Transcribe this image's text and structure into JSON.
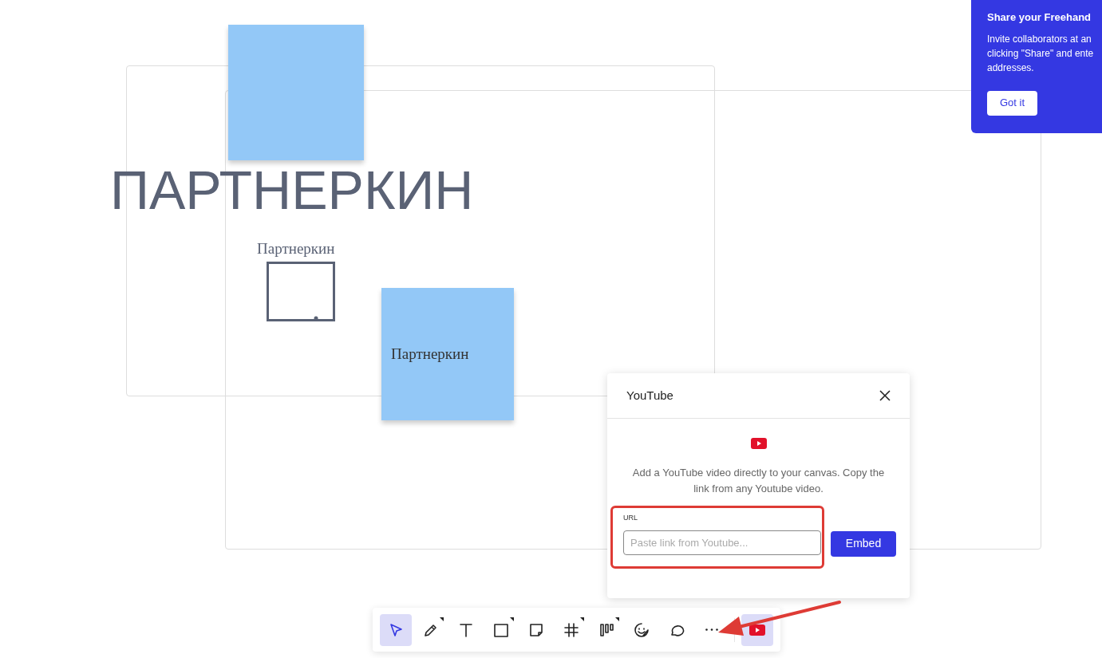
{
  "canvas": {
    "handwriting": "ПАРТНЕРКИН",
    "text_label": "Партнеркин",
    "sticky_notes": [
      {
        "color": "#93c8f7"
      },
      {
        "text": "Партнеркин",
        "color": "#93c8f7"
      }
    ]
  },
  "tip": {
    "title": "Share your Freehand",
    "lines": [
      "Invite collaborators at an",
      "clicking \"Share\" and ente",
      "addresses."
    ],
    "button": "Got it"
  },
  "dialog": {
    "title": "YouTube",
    "description": "Add a YouTube video directly to your canvas. Copy the link from any Youtube video.",
    "field_label": "URL",
    "placeholder": "Paste link from Youtube...",
    "button": "Embed"
  },
  "toolbar": {
    "tools": [
      {
        "kind": "select",
        "selected": true,
        "submenu": false
      },
      {
        "kind": "pen",
        "selected": false,
        "submenu": true
      },
      {
        "kind": "text",
        "selected": false,
        "submenu": false
      },
      {
        "kind": "shape",
        "selected": false,
        "submenu": true
      },
      {
        "kind": "sticky",
        "selected": false,
        "submenu": false
      },
      {
        "kind": "grid",
        "selected": false,
        "submenu": true
      },
      {
        "kind": "columns",
        "selected": false,
        "submenu": true
      },
      {
        "kind": "sticker",
        "selected": false,
        "submenu": false
      },
      {
        "kind": "comment",
        "selected": false,
        "submenu": false
      },
      {
        "kind": "more",
        "selected": false,
        "submenu": false
      },
      {
        "kind": "youtube",
        "selected": true,
        "submenu": false
      }
    ]
  }
}
